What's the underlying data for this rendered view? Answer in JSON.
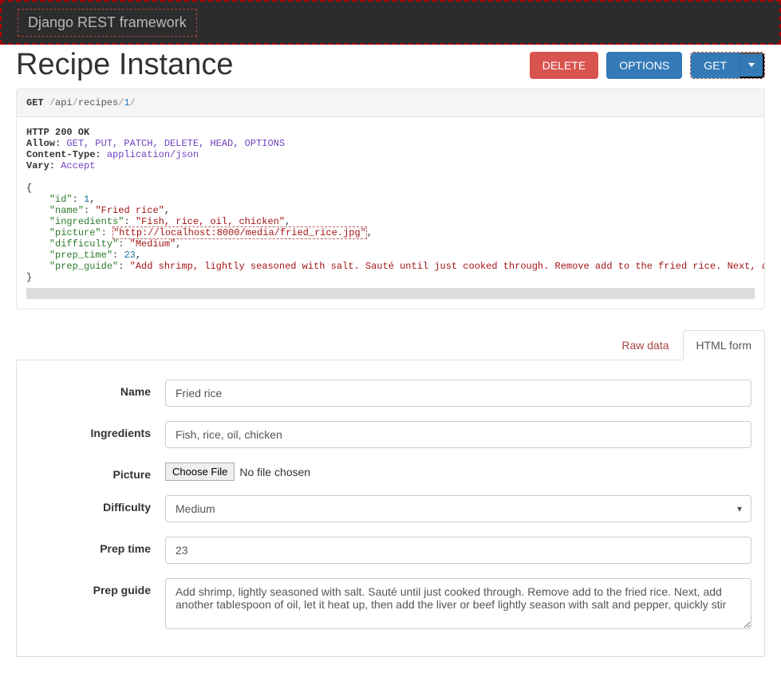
{
  "navbar": {
    "brand": "Django REST framework"
  },
  "page": {
    "title": "Recipe Instance"
  },
  "buttons": {
    "delete": "DELETE",
    "options": "OPTIONS",
    "get": "GET"
  },
  "request": {
    "method": "GET",
    "p1": "api",
    "p2": "recipes",
    "p3": "1"
  },
  "response": {
    "status": "HTTP 200 OK",
    "allow_label": "Allow:",
    "allow_value": "GET, PUT, PATCH, DELETE, HEAD, OPTIONS",
    "ctype_label": "Content-Type:",
    "ctype_value": "application/json",
    "vary_label": "Vary:",
    "vary_value": "Accept",
    "body": {
      "id_key": "\"id\"",
      "id_val": "1",
      "name_key": "\"name\"",
      "name_val": "\"Fried rice\"",
      "ing_key": "\"ingredients\"",
      "ing_val": "\"Fish, rice, oil, chicken\"",
      "pic_key": "\"picture\"",
      "pic_val": "\"http://localhost:8000/media/fried_rice.jpg\"",
      "dif_key": "\"difficulty\"",
      "dif_val": "\"Medium\"",
      "pt_key": "\"prep_time\"",
      "pt_val": "23",
      "pg_key": "\"prep_guide\"",
      "pg_val": "\"Add shrimp, lightly seasoned with salt. Sauté until just cooked through. Remove add to the fried rice. Next, a"
    }
  },
  "tabs": {
    "raw": "Raw data",
    "html": "HTML form"
  },
  "form": {
    "labels": {
      "name": "Name",
      "ingredients": "Ingredients",
      "picture": "Picture",
      "difficulty": "Difficulty",
      "prep_time": "Prep time",
      "prep_guide": "Prep guide"
    },
    "values": {
      "name": "Fried rice",
      "ingredients": "Fish, rice, oil, chicken",
      "choose_file": "Choose File",
      "no_file": "No file chosen",
      "difficulty": "Medium",
      "prep_time": "23",
      "prep_guide": "Add shrimp, lightly seasoned with salt. Sauté until just cooked through. Remove add to the fried rice. Next, add another tablespoon of oil, let it heat up, then add the liver or beef lightly season with salt and pepper, quickly stir"
    }
  }
}
